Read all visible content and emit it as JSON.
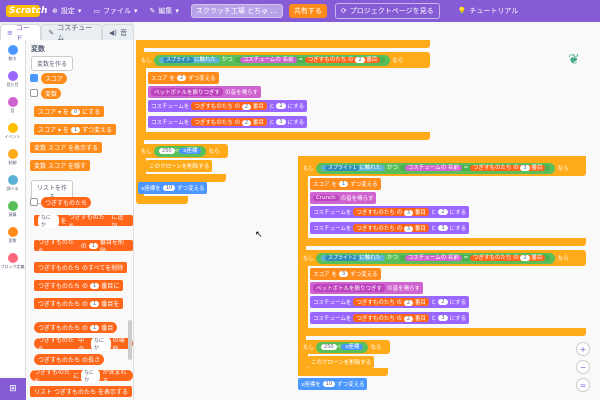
{
  "menubar": {
    "logo": "Scratch",
    "settings": "設定",
    "file": "ファイル",
    "edit": "編集",
    "project_title": "スクラッチ工場 とちゅ ...",
    "share": "共有する",
    "project_page": "プロジェクトページを見る",
    "tutorial": "チュートリアル"
  },
  "tabs": {
    "code": "コード",
    "costume": "コスチューム",
    "sound": "音"
  },
  "categories": [
    {
      "label": "動き",
      "color": "#4c97ff"
    },
    {
      "label": "見た目",
      "color": "#9966ff"
    },
    {
      "label": "音",
      "color": "#cf63cf"
    },
    {
      "label": "イベント",
      "color": "#ffbf00"
    },
    {
      "label": "制御",
      "color": "#ffab19"
    },
    {
      "label": "調べる",
      "color": "#5cb1d6"
    },
    {
      "label": "演算",
      "color": "#59c059"
    },
    {
      "label": "変数",
      "color": "#ff8c1a"
    },
    {
      "label": "ブロック定義",
      "color": "#ff6680"
    }
  ],
  "palette": {
    "heading": "変数",
    "make_var": "変数を作る",
    "var_score": "スコア",
    "var_hensu": "変数",
    "set_score_a": "スコア",
    "set_score_to": "にする",
    "set_score_val": "0",
    "change_score_a": "スコア",
    "change_score_by": "ずつ変える",
    "change_score_val": "1",
    "show_var_a": "変数",
    "show_var_b": "スコア",
    "show_var_c": "を表示する",
    "hide_var_a": "変数",
    "hide_var_b": "スコア",
    "hide_var_c": "を隠す",
    "make_list": "リストを作る",
    "list_name": "つぎすものたち",
    "add_a": "なにか",
    "add_b": "を",
    "add_c": "つぎすものたち",
    "add_d": "に追加",
    "del_a": "つぎすものたち",
    "del_b": "の",
    "del_c": "1",
    "del_d": "番目を削除",
    "delall_a": "つぎすものたち",
    "delall_b": "のすべてを削除",
    "ins_a": "つぎすものたち",
    "ins_b": "の",
    "ins_c": "1",
    "ins_d": "番目に",
    "rep_a": "つぎすものたち",
    "rep_b": "の",
    "rep_c": "1",
    "rep_d": "番目を",
    "item_a": "つぎすものたち",
    "item_b": "の",
    "item_c": "1",
    "item_d": "番目",
    "idx_a": "つぎすものたち",
    "idx_b": "中の",
    "idx_c": "なにか",
    "idx_d": "の場所",
    "len_a": "つぎすものたち",
    "len_b": "の長さ",
    "cont_a": "つぎすものたち",
    "cont_b": "に",
    "cont_c": "なにか",
    "cont_d": "が含まれる",
    "show_list_a": "リスト",
    "show_list_b": "つぎすものたち",
    "show_list_c": "を表示する"
  },
  "script1": {
    "if": "もし",
    "sprite": "スプライト",
    "touched": "に触れた",
    "and": "かつ",
    "costume": "コスチュームの",
    "name": "名前",
    "eq": "=",
    "list": "つぎすものたち",
    "of": "の",
    "idx": "2",
    "nth": "番目",
    "then": "なら",
    "score": "スコア",
    "change_by": "を",
    "score_val": "2",
    "change_text": "ずつ変える",
    "say": "ペットボトルを振りつぎす",
    "say2": "の音を鳴らす",
    "costume_to": "コスチュームを",
    "list2": "つぎすものたち",
    "of2": "の",
    "idx2": "2",
    "nth2": "番目",
    "to": "と",
    "idx3": "2",
    "set_end": "にする",
    "costume_to2": "コスチュームを",
    "list3": "つぎすものたち",
    "of3": "の",
    "idx4": "2",
    "nth3": "番目",
    "to2": "と",
    "idx5": "3",
    "set_end2": "にする",
    "if2": "もし",
    "num250": "250",
    "lt": "<",
    "x": "x座標",
    "then2": "なら",
    "delete_clone": "このクローンを削除する",
    "change_x": "x座標を",
    "x_val": "10",
    "change_x_text": "ずつ変える"
  },
  "script2": {
    "if": "もし",
    "sprite": "スプライト1",
    "touched": "に触れた",
    "and": "かつ",
    "costume": "コスチュームの",
    "name": "名前",
    "list": "つぎすものたち",
    "of": "の",
    "idx": "3",
    "nth": "番目",
    "then": "なら",
    "score": "スコア",
    "change_by": "を",
    "score_val": "1",
    "change_text": "ずつ変える",
    "say": "Crunch",
    "say2": "の音を鳴らす",
    "costume_to": "コスチュームを",
    "list2": "つぎすものたち",
    "of2": "の",
    "idx2": "3",
    "nth2": "番目",
    "to": "と",
    "idx3": "2",
    "set_end": "にする",
    "costume_to2": "コスチュームを",
    "list3": "つぎすものたち",
    "of3": "の",
    "idx4": "3",
    "nth3": "番目",
    "to2": "と",
    "idx5": "3",
    "set_end2": "にする"
  },
  "script3": {
    "if": "もし",
    "sprite": "スプライト2",
    "touched": "に触れた",
    "and": "かつ",
    "costume": "コスチュームの",
    "name": "名前",
    "list": "つぎすものたち",
    "of": "の",
    "idx": "2",
    "nth": "番目",
    "then": "なら",
    "score": "スコア",
    "change_by": "を",
    "score_val": "3",
    "change_text": "ずつ変える",
    "say": "ペットボトルを振りつぎす",
    "say2": "の音を鳴らす",
    "costume_to": "コスチュームを",
    "list2": "つぎすものたち",
    "of2": "の",
    "idx2": "2",
    "nth2": "番目",
    "to": "と",
    "idx3": "2",
    "set_end": "にする",
    "costume_to2": "コスチュームを",
    "list3": "つぎすものたち",
    "of3": "の",
    "idx4": "2",
    "nth3": "番目",
    "to2": "と",
    "idx5": "3",
    "set_end2": "にする",
    "if2": "もし",
    "num250": "250",
    "lt": "<",
    "x": "x座標",
    "then2": "なら",
    "delete_clone": "このクローンを削除する",
    "change_x": "x座標を",
    "x_val": "10",
    "change_x_text": "ずつ変える"
  },
  "zoom": {
    "in": "+",
    "out": "−",
    "reset": "="
  }
}
